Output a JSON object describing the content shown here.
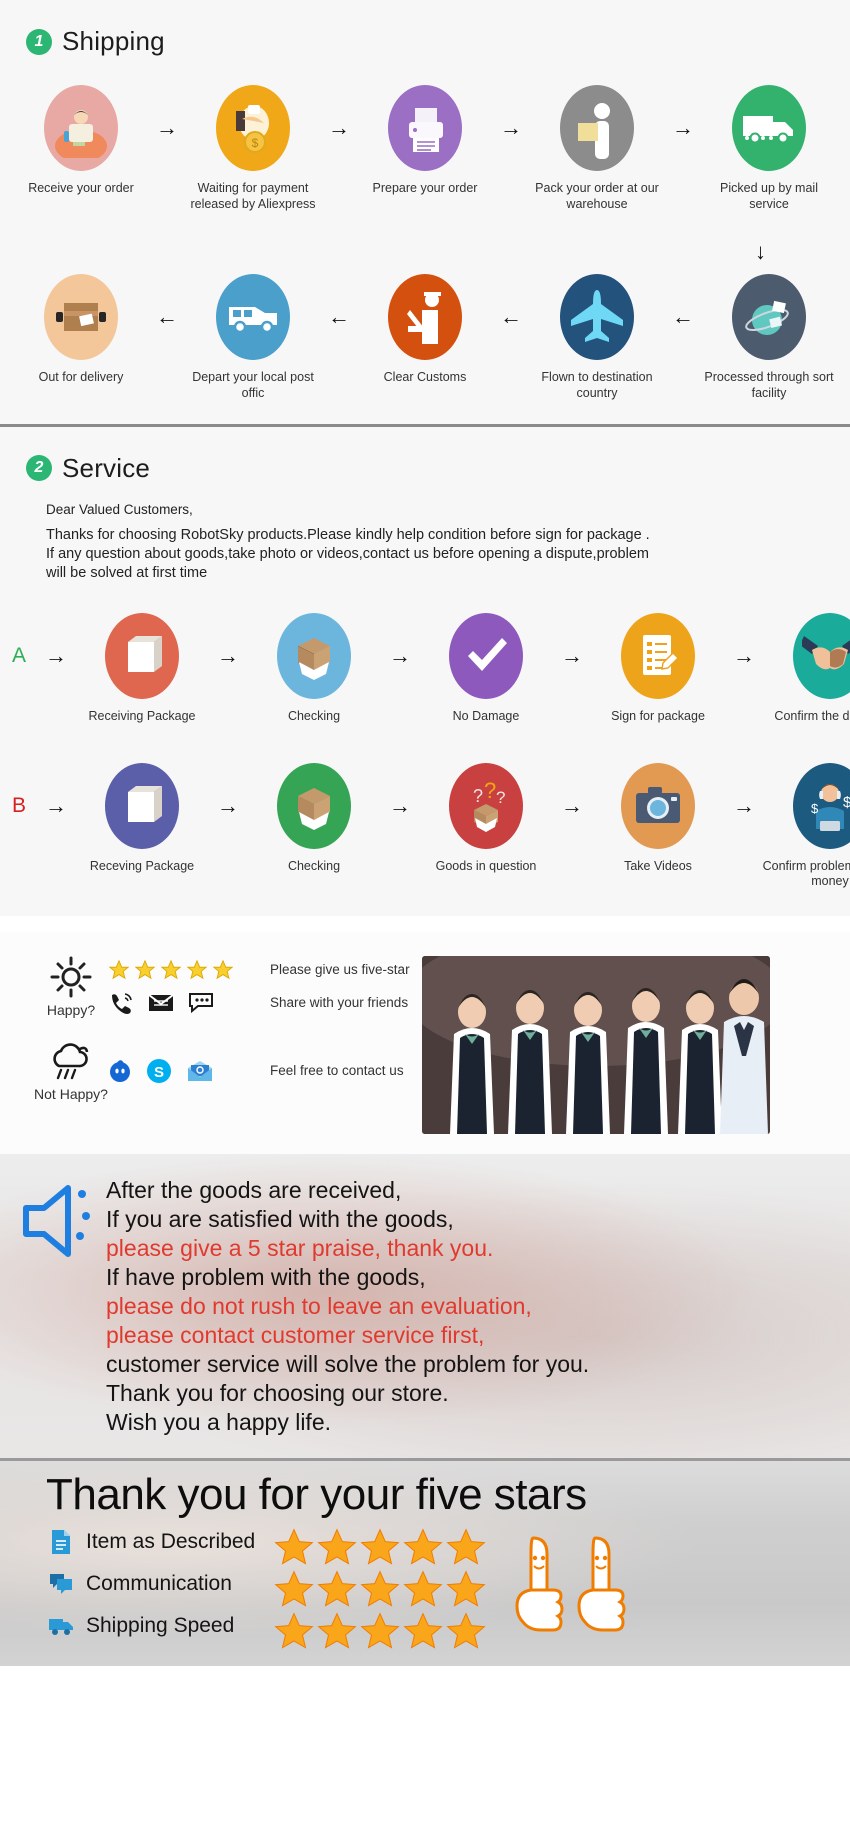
{
  "shipping": {
    "badge": "1",
    "title": "Shipping",
    "row1": [
      {
        "label": "Receive your order",
        "icon": "person-order-icon",
        "color": "#e8a9a4"
      },
      {
        "label": "Waiting for payment released by Aliexpress",
        "icon": "payment-coin-icon",
        "color": "#f0a818"
      },
      {
        "label": "Prepare your order",
        "icon": "printer-icon",
        "color": "#9b6fc4"
      },
      {
        "label": "Pack your order at our warehouse",
        "icon": "packing-worker-icon",
        "color": "#8c8c8c"
      },
      {
        "label": "Picked up by mail service",
        "icon": "delivery-truck-icon",
        "color": "#33b26e"
      }
    ],
    "row2": [
      {
        "label": "Out for delivery",
        "icon": "parcel-box-icon",
        "color": "#f3c79a"
      },
      {
        "label": "Depart your local post offic",
        "icon": "postal-van-icon",
        "color": "#4a9fcb"
      },
      {
        "label": "Clear  Customs",
        "icon": "customs-officer-icon",
        "color": "#d4500f"
      },
      {
        "label": "Flown to destination country",
        "icon": "airplane-icon",
        "color": "#23527c"
      },
      {
        "label": "Processed through sort facility",
        "icon": "globe-parcels-icon",
        "color": "#4d5b6e"
      }
    ],
    "arrow_right": "→",
    "arrow_left": "←",
    "arrow_down": "↓"
  },
  "service": {
    "badge": "2",
    "title": "Service",
    "greeting": "Dear Valued Customers,",
    "body_lines": [
      "Thanks for choosing RobotSky products.Please kindly help condition before sign for package .",
      "If any question about goods,take photo or videos,contact us before opening a dispute,problem",
      "will be solved at first time"
    ],
    "row_a": {
      "letter": "A",
      "letter_color": "#2eae57",
      "steps": [
        {
          "label": "Receiving Package",
          "icon": "package-box-icon",
          "color": "#e0674f"
        },
        {
          "label": "Checking",
          "icon": "open-carton-icon",
          "color": "#6cb6de"
        },
        {
          "label": "No Damage",
          "icon": "checkmark-icon",
          "color": "#8e59bd"
        },
        {
          "label": "Sign for package",
          "icon": "signed-form-icon",
          "color": "#eda41a"
        },
        {
          "label": "Confirm the delivery",
          "icon": "handshake-icon",
          "color": "#1aab9b"
        }
      ]
    },
    "row_b": {
      "letter": "B",
      "letter_color": "#d72020",
      "steps": [
        {
          "label": "Receving Package",
          "icon": "package-box-icon",
          "color": "#5b5ea8"
        },
        {
          "label": "Checking",
          "icon": "open-carton-icon",
          "color": "#35a455"
        },
        {
          "label": "Goods in question",
          "icon": "question-box-icon",
          "color": "#c94040"
        },
        {
          "label": "Take Videos",
          "icon": "camera-icon",
          "color": "#e29a52"
        },
        {
          "label": "Confirm problem, refund money",
          "icon": "agent-refund-icon",
          "color": "#1d5a80"
        }
      ]
    }
  },
  "contact": {
    "happy": {
      "mood_icon": "sun-icon",
      "mood_label": "Happy?",
      "line1": {
        "icons": [
          "star-icon",
          "star-icon",
          "star-icon",
          "star-icon",
          "star-icon"
        ],
        "text": "Please give us five-star"
      },
      "line2": {
        "icons": [
          "phone-ring-icon",
          "envelope-icon",
          "chat-bubble-icon"
        ],
        "text": "Share with your friends"
      }
    },
    "not_happy": {
      "mood_icon": "rain-cloud-icon",
      "mood_label": "Not Happy?",
      "line1": {
        "icons": [
          "messenger-icon",
          "skype-icon",
          "email-open-icon"
        ],
        "text": "Feel free to contact us"
      }
    },
    "photo_alt": "customer-service-team-photo"
  },
  "megaphone": {
    "icon": "megaphone-icon",
    "icon_color": "#1f7fe0",
    "lines": [
      {
        "text": "After the goods are received,",
        "color": "dark"
      },
      {
        "text": "If you are satisfied with the goods,",
        "color": "dark"
      },
      {
        "text": "please give a 5 star praise, thank you.",
        "color": "red"
      },
      {
        "text": "If have problem with the goods,",
        "color": "dark"
      },
      {
        "text": "please do not rush to leave an evaluation,",
        "color": "red"
      },
      {
        "text": "please contact customer service first,",
        "color": "red"
      },
      {
        "text": "customer service will solve the problem for you.",
        "color": "dark"
      },
      {
        "text": "Thank you for choosing our store.",
        "color": "dark"
      },
      {
        "text": "Wish you a happy life.",
        "color": "dark"
      }
    ],
    "red_hex": "#e03a2f",
    "dark_hex": "#141414"
  },
  "thanks": {
    "title": "Thank you for your five stars",
    "rows": [
      {
        "icon": "document-icon",
        "label": "Item as Described",
        "stars": 5
      },
      {
        "icon": "chat-icon",
        "label": "Communication",
        "stars": 5
      },
      {
        "icon": "truck-icon",
        "label": "Shipping  Speed",
        "stars": 5
      }
    ],
    "thumbs": [
      "thumbs-up-icon",
      "thumbs-up-icon"
    ],
    "star_color": "#f5a623",
    "icon_color": "#1f8fd6"
  }
}
